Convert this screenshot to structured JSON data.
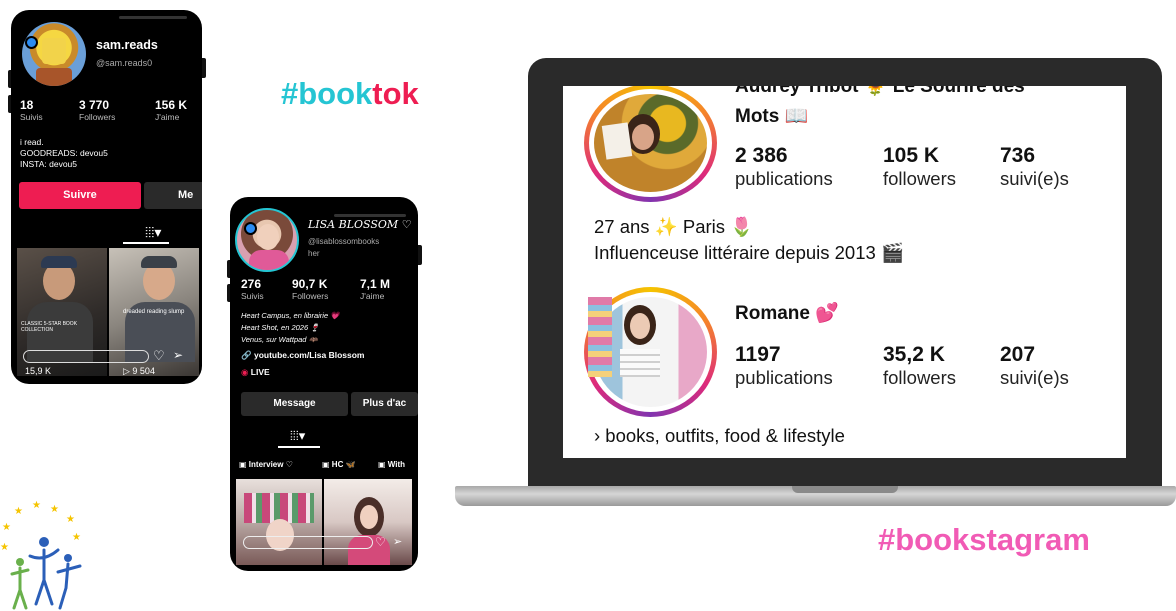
{
  "hashtag_booktok": {
    "part1": "#book",
    "part2": "tok"
  },
  "hashtag_bookstagram": "#bookstagram",
  "phone1": {
    "username": "sam.reads",
    "handle": "@sam.reads0",
    "stats": [
      {
        "num": "18",
        "label": "Suivis"
      },
      {
        "num": "3 770",
        "label": "Followers"
      },
      {
        "num": "156 K",
        "label": "J'aime"
      }
    ],
    "bio": [
      "i read.",
      "GOODREADS: devou5",
      "INSTA: devou5"
    ],
    "follow_label": "Suivre",
    "message_label": "Me",
    "video_text_left": "CLASSIC 5-STAR BOOK COLLECTION",
    "video_text_right": "dreaded reading slump",
    "views_left": "15,9 K",
    "views_right": "▷ 9 504"
  },
  "phone2": {
    "username": "LISA BLOSSOM ♡",
    "handle": "@lisablossombooks",
    "handle_cont": "her",
    "stats": [
      {
        "num": "276",
        "label": "Suivis"
      },
      {
        "num": "90,7 K",
        "label": "Followers"
      },
      {
        "num": "7,1 M",
        "label": "J'aime"
      }
    ],
    "bio": [
      "Heart Campus, en librairie 💗",
      "Heart Shot, en 2026 🍷",
      "Venus, sur Wattpad 🦇"
    ],
    "link": "youtube.com/Lisa Blossom",
    "live": "LIVE",
    "message_label": "Message",
    "more_label": "Plus d'ac",
    "playlists": [
      "Interview ♡",
      "HC 🦋",
      "With"
    ]
  },
  "ig1": {
    "name_line1": "Audrey Tribot 🌻 Le Sourire des",
    "name_line2": "Mots 📖",
    "stats": [
      {
        "num": "2 386",
        "label": "publications"
      },
      {
        "num": "105 K",
        "label": "followers"
      },
      {
        "num": "736",
        "label": "suivi(e)s"
      }
    ],
    "bio": [
      "27 ans ✨ Paris 🌷",
      "Influenceuse littéraire depuis 2013 🎬"
    ]
  },
  "ig2": {
    "name": "Romane 💕",
    "stats": [
      {
        "num": "1197",
        "label": "publications"
      },
      {
        "num": "35,2 K",
        "label": "followers"
      },
      {
        "num": "207",
        "label": "suivi(e)s"
      }
    ],
    "bio": [
      "› books, outfits, food & lifestyle"
    ]
  },
  "colors": {
    "tiktok_red": "#ee1d52",
    "tiktok_cyan": "#25c5d3",
    "insta_pink": "#f15bb5"
  }
}
